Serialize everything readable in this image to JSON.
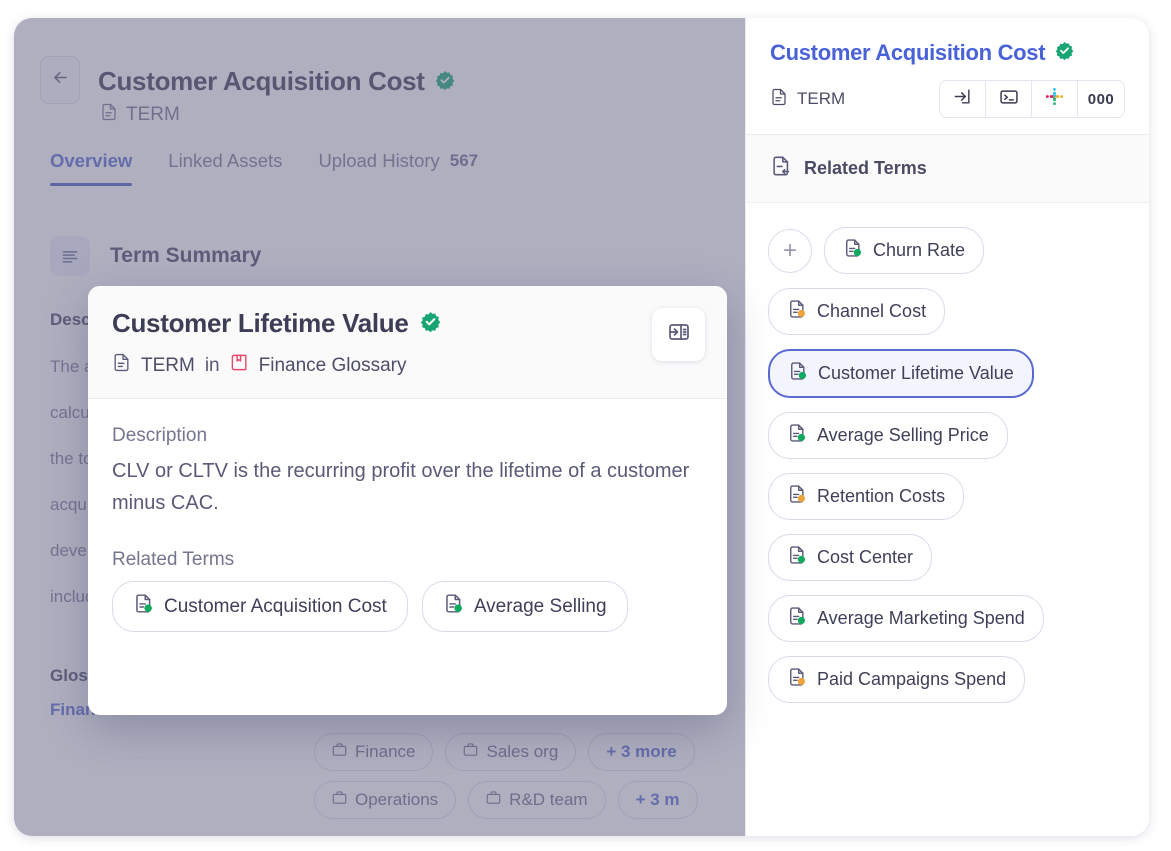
{
  "main": {
    "title": "Customer Acquisition Cost",
    "verified_icon": "verified-badge-icon",
    "subtype": "TERM",
    "back_icon": "back-arrow-icon",
    "tabs": [
      {
        "label": "Overview",
        "count": "",
        "active": true
      },
      {
        "label": "Linked Assets",
        "count": "",
        "active": false
      },
      {
        "label": "Upload History",
        "count": "567",
        "active": false
      }
    ],
    "summary_title": "Term Summary",
    "summary_icon": "list-lines-icon",
    "description_label": "Descr",
    "description_lines": [
      "The a…",
      "calcul…",
      "the to…",
      "acquis…",
      "devel…",
      "includ…"
    ],
    "glossary_label": "Gloss…",
    "glossary_value": "Finan…",
    "chips": [
      {
        "label": "Finance",
        "icon": "briefcase-icon",
        "more": false
      },
      {
        "label": "Sales org",
        "icon": "briefcase-icon",
        "more": false
      },
      {
        "label": "+ 3 more",
        "icon": "",
        "more": true
      },
      {
        "label": "Operations",
        "icon": "briefcase-icon",
        "more": false
      },
      {
        "label": "R&D team",
        "icon": "briefcase-icon",
        "more": false
      },
      {
        "label": "+ 3 m",
        "icon": "",
        "more": true
      }
    ]
  },
  "sidebar": {
    "title": "Customer Acquisition Cost",
    "subtype": "TERM",
    "actions": [
      {
        "name": "open-in-panel-icon",
        "label": ""
      },
      {
        "name": "terminal-icon",
        "label": ""
      },
      {
        "name": "slack-icon",
        "label": ""
      },
      {
        "name": "more-options-icon",
        "label": "000"
      }
    ],
    "section_title": "Related Terms",
    "section_icon": "related-terms-icon",
    "add_label": "+",
    "terms": [
      {
        "label": "Churn Rate",
        "status": "green",
        "selected": false
      },
      {
        "label": "Channel Cost",
        "status": "amber",
        "selected": false
      },
      {
        "label": "Customer Lifetime Value",
        "status": "green",
        "selected": true
      },
      {
        "label": "Average Selling Price",
        "status": "green",
        "selected": false
      },
      {
        "label": "Retention Costs",
        "status": "amber",
        "selected": false
      },
      {
        "label": "Cost Center",
        "status": "green",
        "selected": false
      },
      {
        "label": "Average Marketing Spend",
        "status": "green",
        "selected": false
      },
      {
        "label": "Paid Campaigns Spend",
        "status": "amber",
        "selected": false
      }
    ]
  },
  "popup": {
    "title": "Customer Lifetime Value",
    "subtype": "TERM",
    "in_word": "in",
    "glossary": "Finance Glossary",
    "expand_icon": "open-in-panel-icon",
    "description_label": "Description",
    "description": "CLV or CLTV is the recurring profit over the lifetime of a customer minus CAC.",
    "related_label": "Related Terms",
    "related_terms": [
      {
        "label": "Customer Acquisition Cost",
        "status": "green"
      },
      {
        "label": "Average Selling",
        "status": "green"
      }
    ]
  },
  "colors": {
    "accent_blue": "#4a62d8",
    "tab_active": "#5b6ad0",
    "verified_green": "#0faa5f",
    "status_green": "#0faa5f",
    "status_amber": "#eba43b",
    "glossary_pink": "#e8496b",
    "text_dark": "#3d3d56",
    "text_muted": "#75758f"
  }
}
